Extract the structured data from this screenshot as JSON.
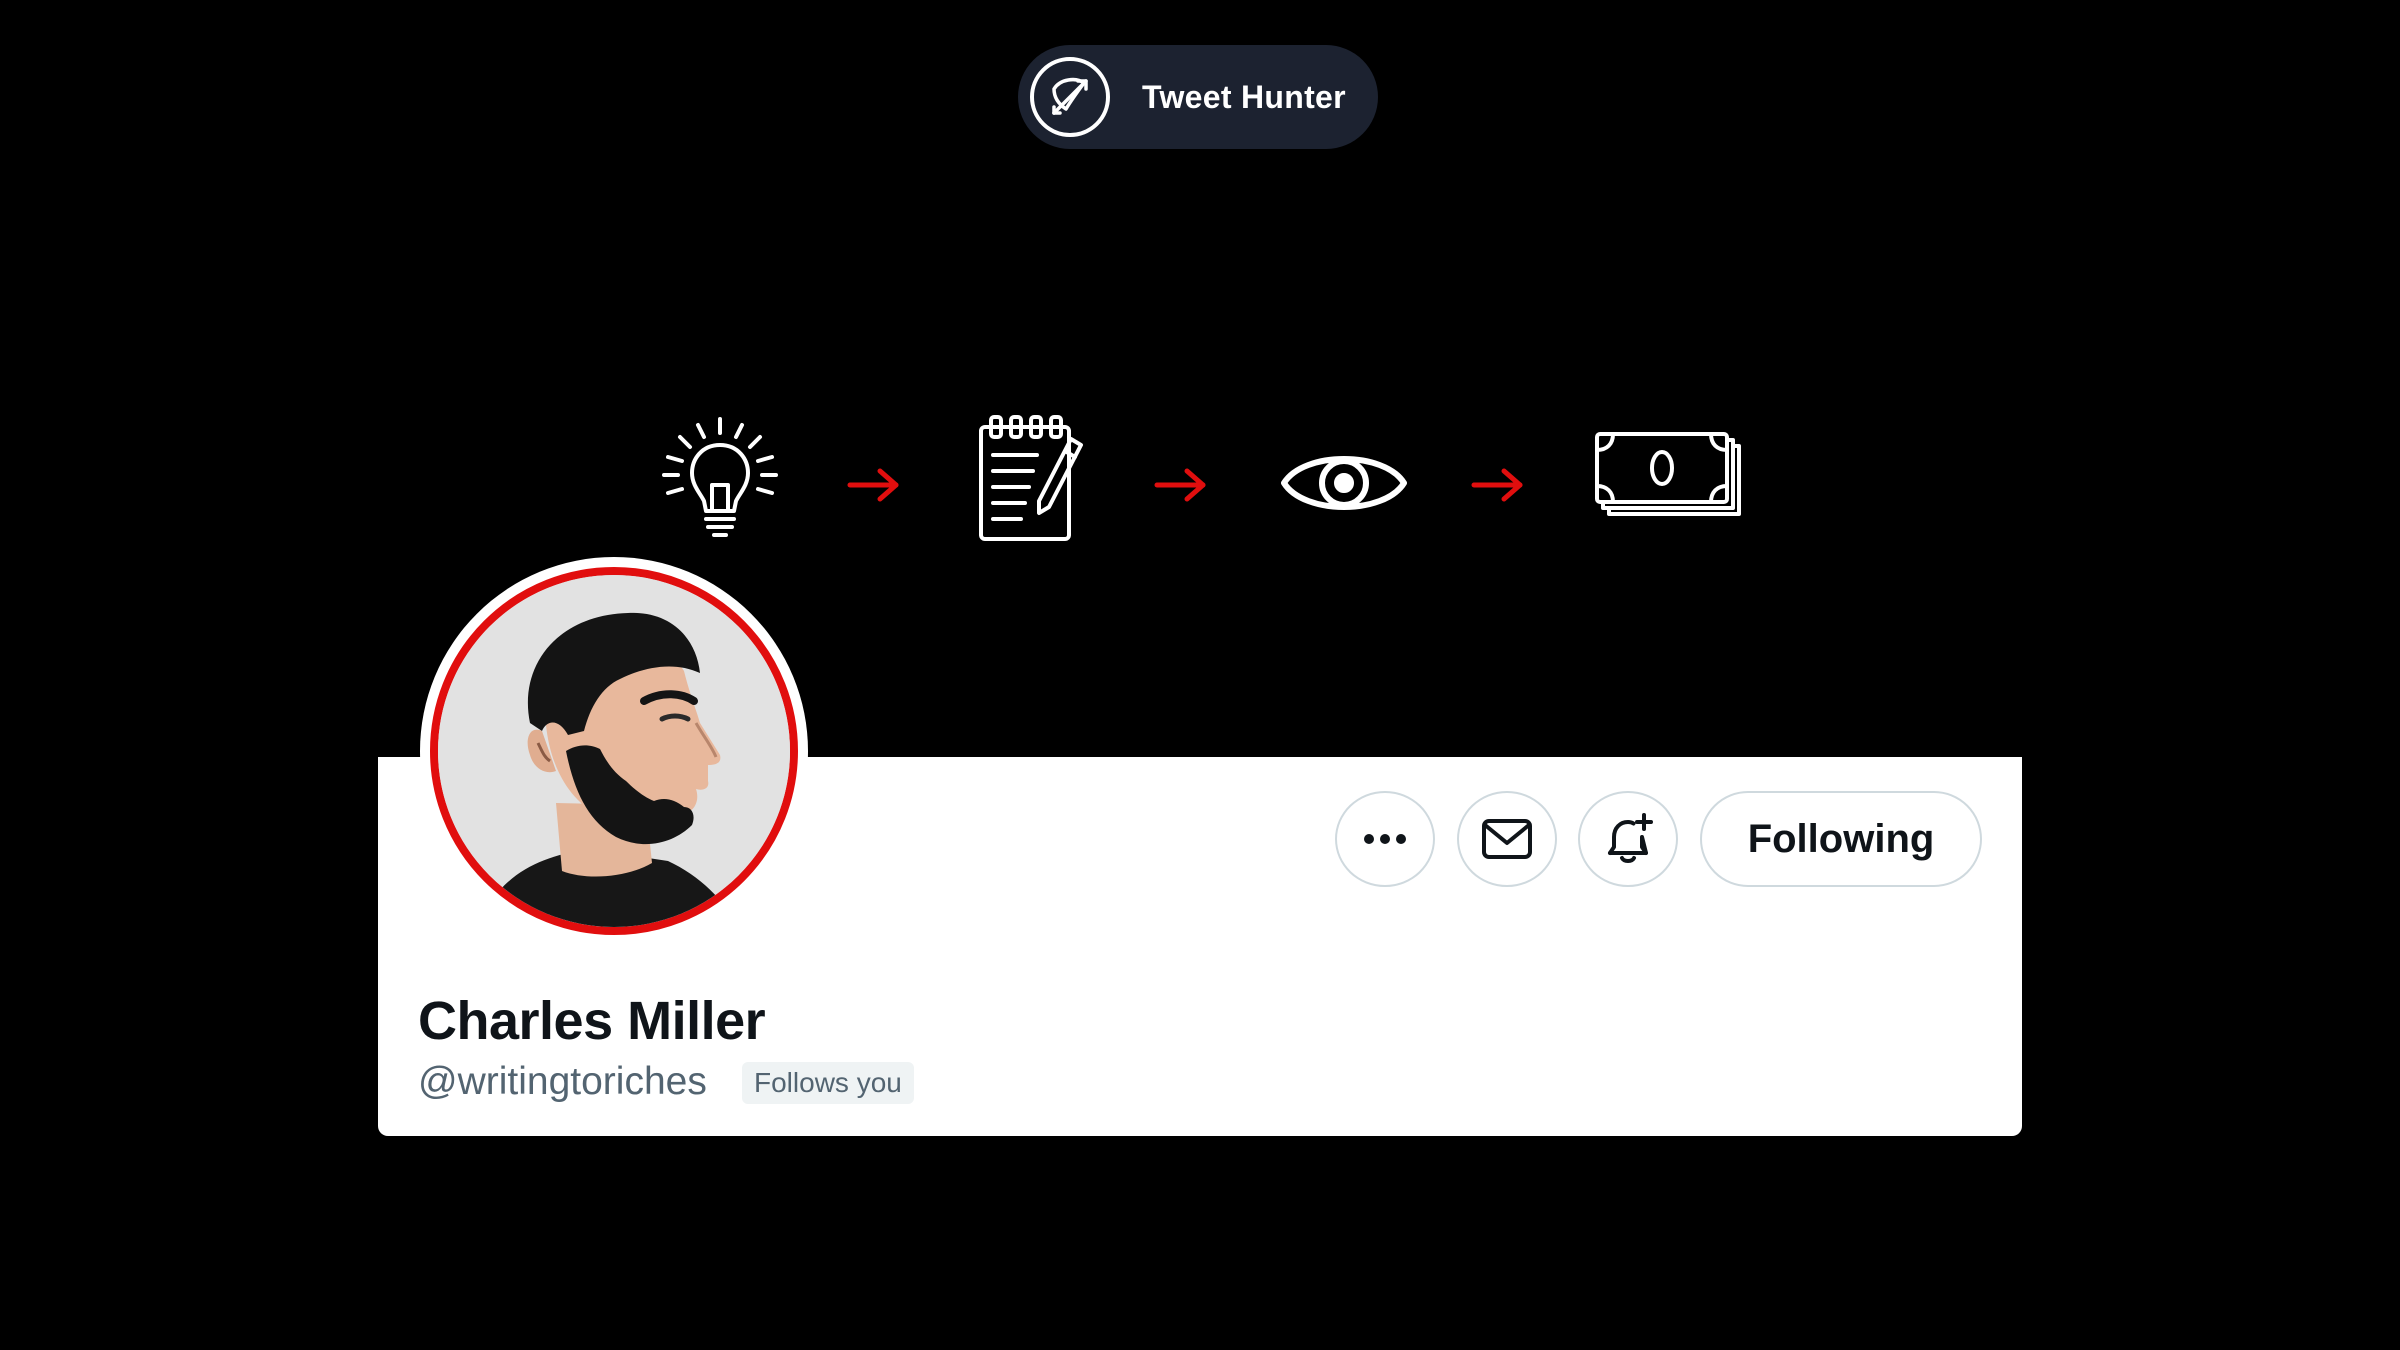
{
  "brand": {
    "name": "Tweet Hunter",
    "logo_icon": "bow-and-arrow-icon",
    "pill_color": "#1c2230"
  },
  "banner": {
    "flow_icons": [
      "lightbulb-icon",
      "notepad-icon",
      "eye-icon",
      "money-stack-icon"
    ],
    "arrow_icon": "arrow-right-icon",
    "arrow_color": "#e10e0e"
  },
  "profile": {
    "name": "Charles Miller",
    "handle": "@writingtoriches",
    "follows_you_label": "Follows you",
    "following_label": "Following",
    "avatar_ring_color": "#e10e0e"
  },
  "actions": {
    "more_icon": "more-icon",
    "message_icon": "mail-icon",
    "notify_icon": "bell-plus-icon"
  }
}
